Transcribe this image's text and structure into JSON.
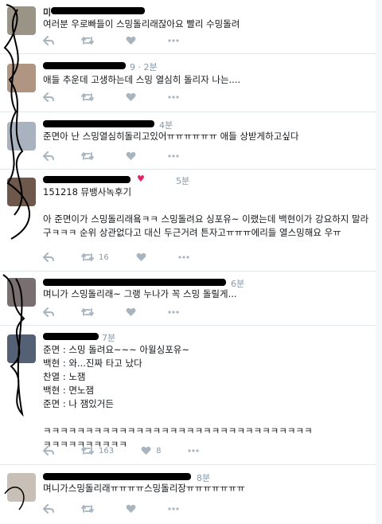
{
  "tweets": [
    {
      "name": "미",
      "time": "",
      "text": "여러분 우로빠들이 스밍돌리래잖아요 빨리 수밍돌려",
      "retweets": "",
      "likes": ""
    },
    {
      "name": "",
      "time": "9 · 2분",
      "text": "애들 추운데 고생하는데 스밍 열심히 돌리자 나는....",
      "retweets": "",
      "likes": ""
    },
    {
      "name": "",
      "time": "4분",
      "text": "준면아 난 스밍열심히돌리고있어ㅠㅠㅠㅠㅠㅠ 애들 상받게하고싶다",
      "retweets": "",
      "likes": ""
    },
    {
      "name": "",
      "time": "5분",
      "text": "151218 뮤뱅사녹후기\n\n아 준면이가 스밍돌리래욬ㅋㅋ 스밍돌려요 싱포유~ 이랬는데 백현이가 강요하지 말라구ㅋㅋㅋ 순위 상관없다고 대신 두근거려 튼자고ㅠㅠㅠ에리들 열스밍해요 우ㅠ",
      "retweets": "16",
      "likes": ""
    },
    {
      "name": "",
      "time": "6분",
      "text": "며니가 스밍돌리래~ 그랭 누나가 꼭 스밍 돌릴게...",
      "retweets": "",
      "likes": ""
    },
    {
      "name": "",
      "time": "7분",
      "text": "준면 : 스밍 돌려요~~~ 아윌싱포유~\n백현 : 와...진짜 타고 났다\n찬열 : 노잼\n백현 : 면노잼\n준면 : 나 잼있거든\n\nㅋㅋㅋㅋㅋㅋㅋㅋㅋㅋㅋㅋㅋㅋㅋㅋㅋㅋㅋㅋㅋㅋㅋㅋㅋㅋㅋㅋㅋㅋㅋㅋ\nㅋㅋㅋㅋㅋㅋㅋㅋㅋㅋ",
      "retweets": "163",
      "likes": "8"
    },
    {
      "name": "",
      "time": "8분",
      "text": "며니가스밍돌리래ㅠㅠㅠㅠ스밍돌리장ㅠㅠㅠㅠㅠㅠㅠ",
      "retweets": "",
      "likes": ""
    }
  ],
  "colors": {
    "icon": "#a8b5bf",
    "meta": "#8899a6",
    "text": "#14171a",
    "heart": "#e0245e"
  },
  "icons": [
    "reply-icon",
    "retweet-icon",
    "like-icon",
    "more-icon"
  ]
}
